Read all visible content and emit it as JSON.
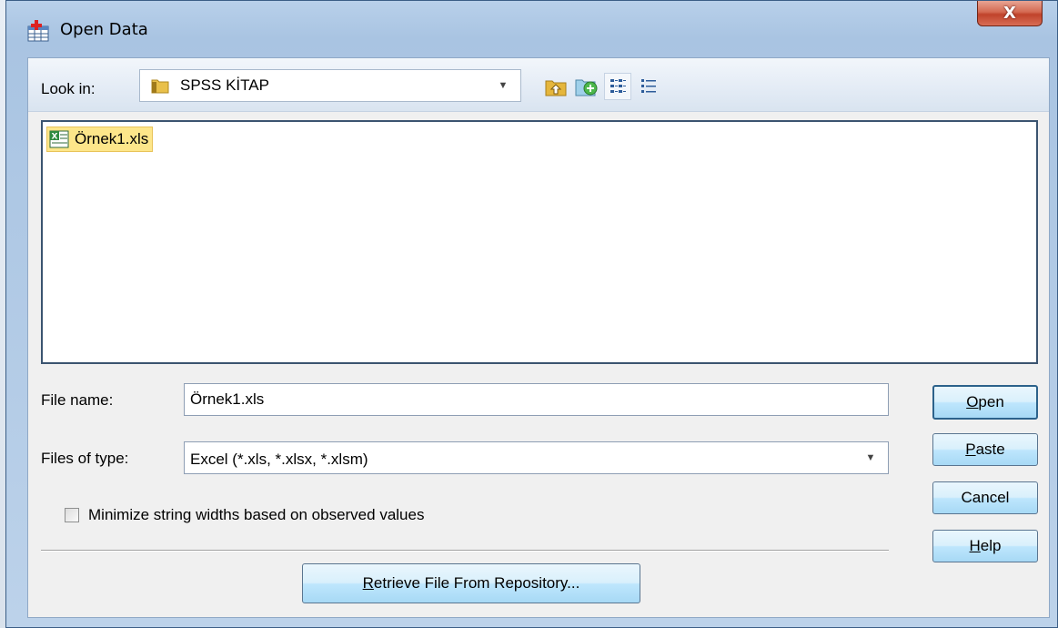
{
  "window": {
    "title": "Open Data",
    "close_label": "X"
  },
  "lookin": {
    "label": "Look in:",
    "value": "SPSS KİTAP"
  },
  "file_list": {
    "items": [
      {
        "name": "Örnek1.xls",
        "icon": "excel-file-icon",
        "selected": true
      }
    ]
  },
  "file_name": {
    "label": "File name:",
    "value": "Örnek1.xls"
  },
  "files_of_type": {
    "label": "Files of type:",
    "value": "Excel (*.xls, *.xlsx, *.xlsm)"
  },
  "options": {
    "minimize_label": "Minimize string widths based on observed values",
    "minimize_checked": false
  },
  "buttons": {
    "open_mnemonic": "O",
    "open_rest": "pen",
    "paste_mnemonic": "P",
    "paste_rest": "aste",
    "cancel": "Cancel",
    "help_mnemonic": "H",
    "help_rest": "elp",
    "retrieve_mnemonic": "R",
    "retrieve_rest": "etrieve File From Repository..."
  },
  "colors": {
    "selection": "#fde68a",
    "title_bar": "#a9c4e2",
    "close_button": "#c0432b"
  }
}
